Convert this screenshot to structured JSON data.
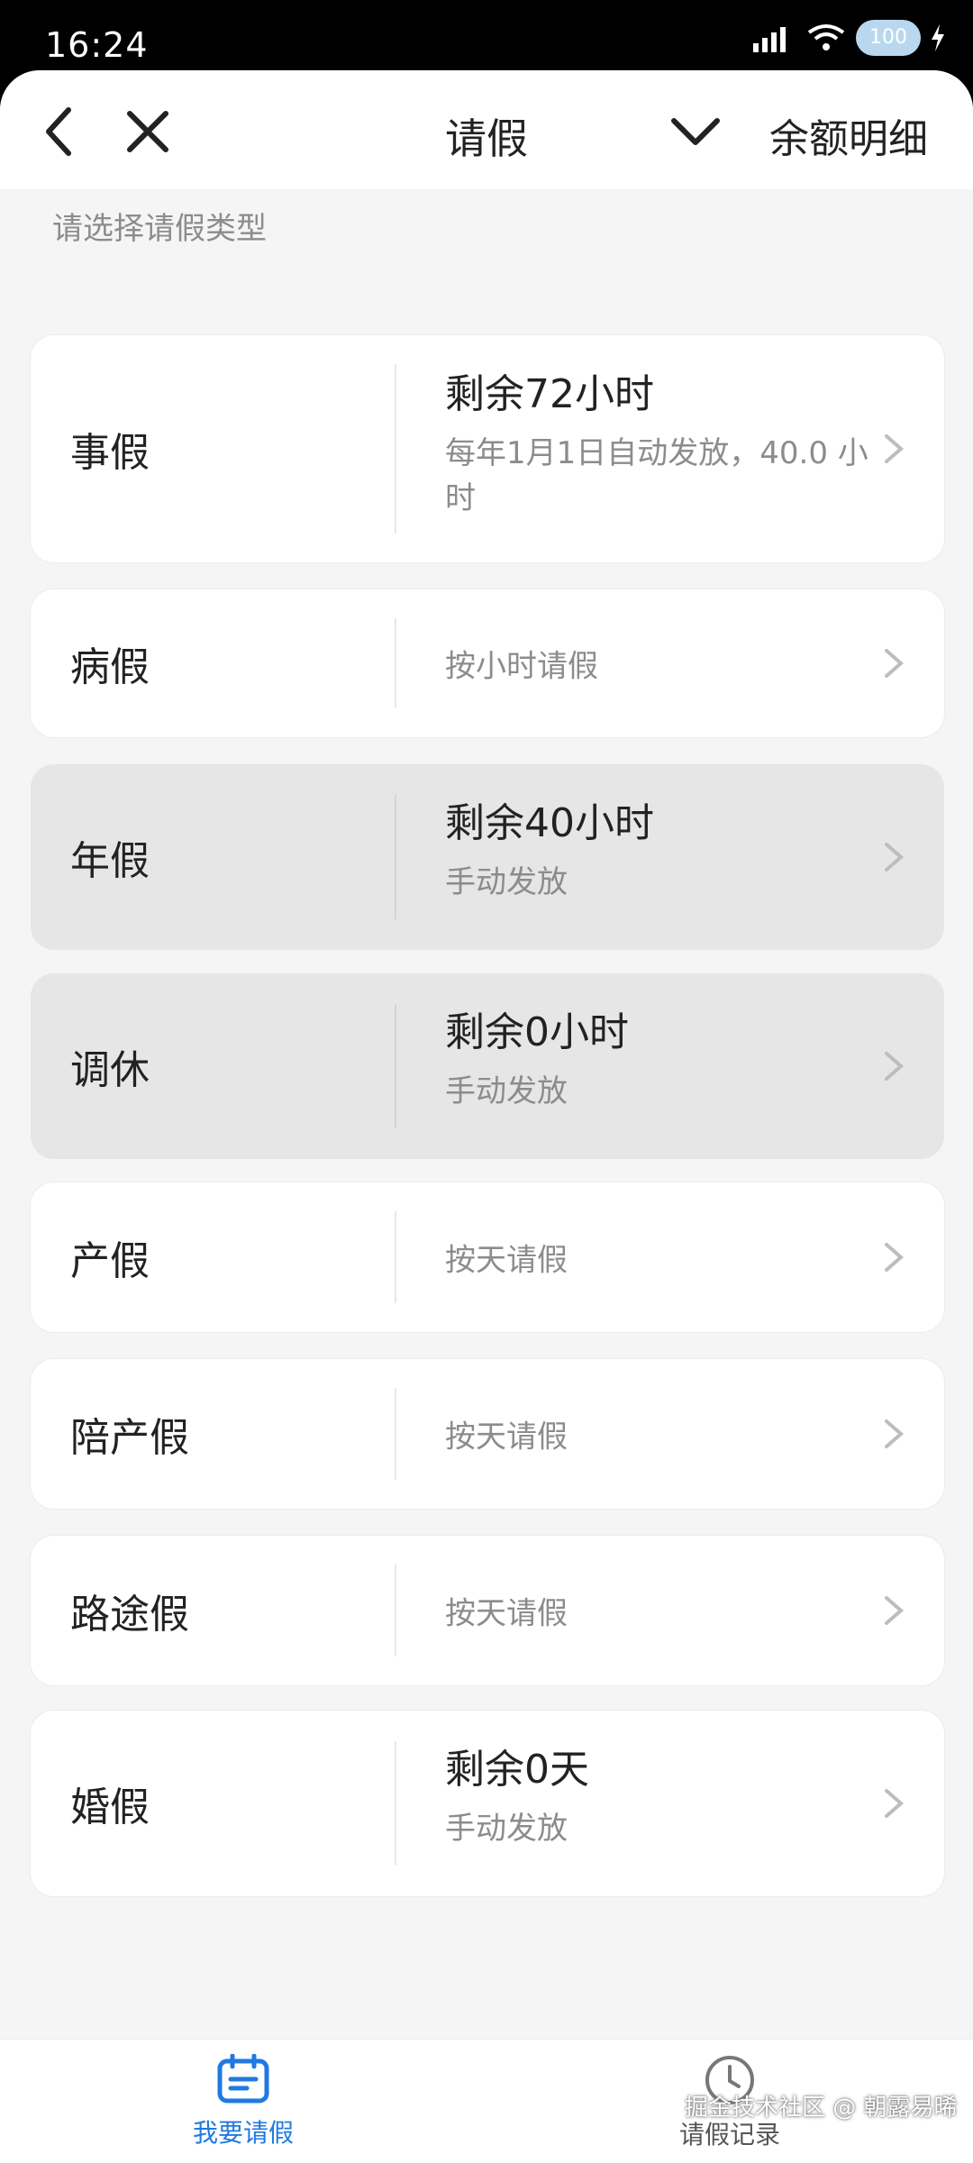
{
  "status_bar": {
    "time": "16:24",
    "battery": "100"
  },
  "header": {
    "title": "请假",
    "right_link": "余额明细"
  },
  "section_label": "请选择请假类型",
  "leave_types": [
    {
      "name": "事假",
      "main": "剩余72小时",
      "sub": "每年1月1日自动发放，40.0 小时"
    },
    {
      "name": "病假",
      "simple": "按小时请假"
    },
    {
      "name": "年假",
      "main": "剩余40小时",
      "sub": "手动发放"
    },
    {
      "name": "调休",
      "main": "剩余0小时",
      "sub": "手动发放"
    },
    {
      "name": "产假",
      "simple": "按天请假"
    },
    {
      "name": "陪产假",
      "simple": "按天请假"
    },
    {
      "name": "路途假",
      "simple": "按天请假"
    },
    {
      "name": "婚假",
      "main": "剩余0天",
      "sub": "手动发放"
    }
  ],
  "bottom_nav": {
    "left_label": "我要请假",
    "right_label": "请假记录"
  },
  "watermark": "掘金技术社区 @ 朝露易晞",
  "colors": {
    "accent": "#1f7ae0",
    "disabled_bg": "#e6e6e6",
    "page_bg": "#f5f5f5"
  }
}
